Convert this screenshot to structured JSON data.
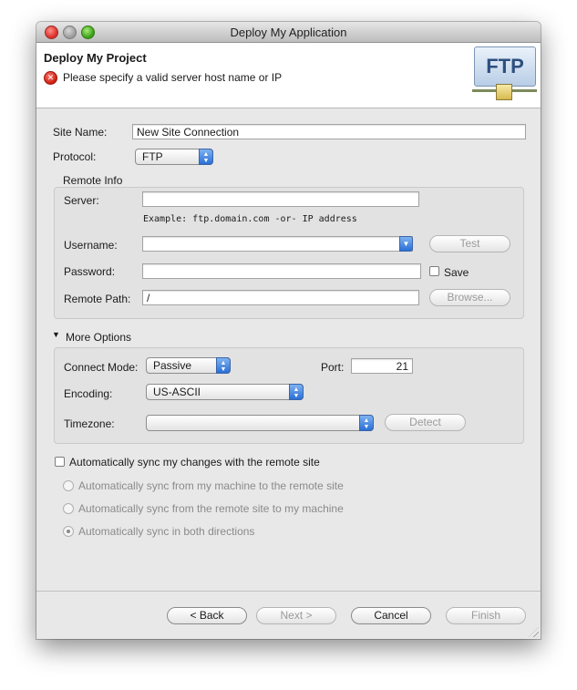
{
  "window": {
    "title": "Deploy My Application"
  },
  "header": {
    "title": "Deploy My Project",
    "error_message": "Please specify a valid server host name or IP",
    "badge_text": "FTP"
  },
  "form": {
    "site_name_label": "Site Name:",
    "site_name_value": "New Site Connection",
    "protocol_label": "Protocol:",
    "protocol_value": "FTP"
  },
  "remote_info": {
    "group_label": "Remote Info",
    "server_label": "Server:",
    "server_value": "",
    "server_hint": "Example: ftp.domain.com -or- IP address",
    "username_label": "Username:",
    "username_value": "",
    "test_button": "Test",
    "password_label": "Password:",
    "password_value": "",
    "save_label": "Save",
    "remote_path_label": "Remote Path:",
    "remote_path_value": "/",
    "browse_button": "Browse..."
  },
  "more_options": {
    "toggle_label": "More Options",
    "connect_mode_label": "Connect Mode:",
    "connect_mode_value": "Passive",
    "port_label": "Port:",
    "port_value": "21",
    "encoding_label": "Encoding:",
    "encoding_value": "US-ASCII",
    "timezone_label": "Timezone:",
    "timezone_value": "",
    "detect_button": "Detect"
  },
  "sync": {
    "auto_sync_label": "Automatically sync my changes with the remote site",
    "options": [
      {
        "label": "Automatically sync from my machine to the remote site",
        "selected": false
      },
      {
        "label": "Automatically sync from the remote site to my machine",
        "selected": false
      },
      {
        "label": "Automatically sync in both directions",
        "selected": true
      }
    ]
  },
  "footer": {
    "back_button": "< Back",
    "next_button": "Next >",
    "cancel_button": "Cancel",
    "finish_button": "Finish"
  },
  "colors": {
    "accent": "#2a6fd6",
    "error": "#cc1d10",
    "window_bg": "#e8e8e8"
  },
  "icons": [
    "close-icon",
    "minimize-icon",
    "zoom-icon",
    "error-icon",
    "ftp-icon",
    "disclosure-triangle-icon",
    "chevron-down-icon",
    "popup-arrows-icon",
    "resize-grip-icon"
  ]
}
